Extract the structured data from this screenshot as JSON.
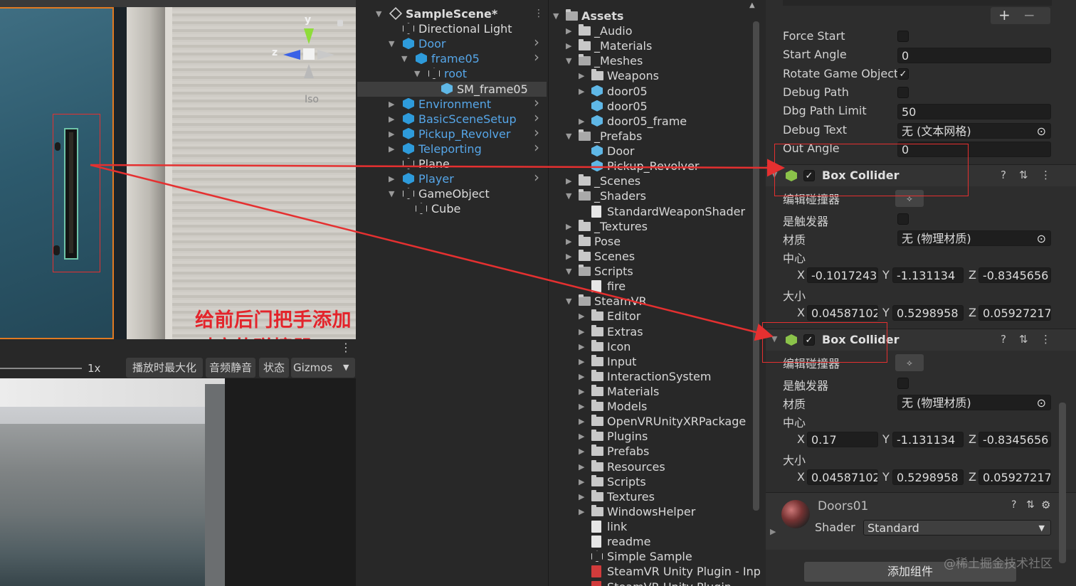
{
  "scene": {
    "gizmo": {
      "y": "y",
      "z": "z"
    },
    "projection": "Iso",
    "annotation": "给前后门把手添加对应的碰撞器"
  },
  "game_toolbar": {
    "scale": "1x",
    "maximize_on_play": "播放时最大化",
    "mute_audio": "音频静音",
    "stats": "状态",
    "gizmos": "Gizmos"
  },
  "hierarchy": {
    "items": [
      {
        "label": "SampleScene*",
        "depth": 0,
        "icon": "unity-scene-icon",
        "color": "white",
        "expanded": true,
        "bold": true,
        "menu": true
      },
      {
        "label": "Directional Light",
        "depth": 1,
        "icon": "gameobject-icon",
        "color": "white"
      },
      {
        "label": "Door",
        "depth": 1,
        "icon": "prefab-icon",
        "color": "blue",
        "expanded": true,
        "chevron": true
      },
      {
        "label": "frame05",
        "depth": 2,
        "icon": "prefab-icon",
        "color": "blue",
        "expanded": true,
        "chevron": true
      },
      {
        "label": "root",
        "depth": 3,
        "icon": "gameobject-icon",
        "color": "blue",
        "expanded": true
      },
      {
        "label": "SM_frame05",
        "depth": 4,
        "icon": "mesh-icon",
        "color": "white",
        "selected": true
      },
      {
        "label": "Environment",
        "depth": 1,
        "icon": "prefab-icon",
        "color": "blue",
        "collapsed": true,
        "chevron": true
      },
      {
        "label": "BasicSceneSetup",
        "depth": 1,
        "icon": "prefab-icon",
        "color": "blue",
        "collapsed": true,
        "chevron": true
      },
      {
        "label": "Pickup_Revolver",
        "depth": 1,
        "icon": "prefab-icon",
        "color": "blue",
        "collapsed": true,
        "chevron": true
      },
      {
        "label": "Teleporting",
        "depth": 1,
        "icon": "prefab-icon",
        "color": "blue",
        "collapsed": true,
        "chevron": true
      },
      {
        "label": "Plane",
        "depth": 1,
        "icon": "gameobject-icon",
        "color": "white"
      },
      {
        "label": "Player",
        "depth": 1,
        "icon": "prefab-icon",
        "color": "blue",
        "collapsed": true,
        "chevron": true
      },
      {
        "label": "GameObject",
        "depth": 1,
        "icon": "gameobject-icon",
        "color": "white",
        "expanded": true
      },
      {
        "label": "Cube",
        "depth": 2,
        "icon": "gameobject-icon",
        "color": "white"
      }
    ]
  },
  "project": {
    "items": [
      {
        "label": "Assets",
        "depth": 0,
        "type": "folder-open",
        "bold": true,
        "expanded": true
      },
      {
        "label": "_Audio",
        "depth": 1,
        "type": "folder",
        "collapsed": true
      },
      {
        "label": "_Materials",
        "depth": 1,
        "type": "folder",
        "collapsed": true
      },
      {
        "label": "_Meshes",
        "depth": 1,
        "type": "folder-open",
        "expanded": true
      },
      {
        "label": "Weapons",
        "depth": 2,
        "type": "folder",
        "collapsed": true
      },
      {
        "label": "door05",
        "depth": 2,
        "type": "model",
        "collapsed": true
      },
      {
        "label": "door05",
        "depth": 2,
        "type": "model"
      },
      {
        "label": "door05_frame",
        "depth": 2,
        "type": "model",
        "collapsed": true
      },
      {
        "label": "_Prefabs",
        "depth": 1,
        "type": "folder-open",
        "expanded": true
      },
      {
        "label": "Door",
        "depth": 2,
        "type": "prefab"
      },
      {
        "label": "Pickup_Revolver",
        "depth": 2,
        "type": "prefab"
      },
      {
        "label": "_Scenes",
        "depth": 1,
        "type": "folder",
        "collapsed": true
      },
      {
        "label": "_Shaders",
        "depth": 1,
        "type": "folder-open",
        "expanded": true
      },
      {
        "label": "StandardWeaponShader",
        "depth": 2,
        "type": "shader"
      },
      {
        "label": "_Textures",
        "depth": 1,
        "type": "folder",
        "collapsed": true
      },
      {
        "label": "Pose",
        "depth": 1,
        "type": "folder",
        "collapsed": true
      },
      {
        "label": "Scenes",
        "depth": 1,
        "type": "folder",
        "collapsed": true
      },
      {
        "label": "Scripts",
        "depth": 1,
        "type": "folder-open",
        "expanded": true
      },
      {
        "label": "fire",
        "depth": 2,
        "type": "script"
      },
      {
        "label": "SteamVR",
        "depth": 1,
        "type": "folder-open",
        "expanded": true
      },
      {
        "label": "Editor",
        "depth": 2,
        "type": "folder",
        "collapsed": true
      },
      {
        "label": "Extras",
        "depth": 2,
        "type": "folder",
        "collapsed": true
      },
      {
        "label": "Icon",
        "depth": 2,
        "type": "folder",
        "collapsed": true
      },
      {
        "label": "Input",
        "depth": 2,
        "type": "folder",
        "collapsed": true
      },
      {
        "label": "InteractionSystem",
        "depth": 2,
        "type": "folder",
        "collapsed": true
      },
      {
        "label": "Materials",
        "depth": 2,
        "type": "folder",
        "collapsed": true
      },
      {
        "label": "Models",
        "depth": 2,
        "type": "folder",
        "collapsed": true
      },
      {
        "label": "OpenVRUnityXRPackage",
        "depth": 2,
        "type": "folder",
        "collapsed": true
      },
      {
        "label": "Plugins",
        "depth": 2,
        "type": "folder",
        "collapsed": true
      },
      {
        "label": "Prefabs",
        "depth": 2,
        "type": "folder",
        "collapsed": true
      },
      {
        "label": "Resources",
        "depth": 2,
        "type": "folder",
        "collapsed": true
      },
      {
        "label": "Scripts",
        "depth": 2,
        "type": "folder",
        "collapsed": true
      },
      {
        "label": "Textures",
        "depth": 2,
        "type": "folder",
        "collapsed": true
      },
      {
        "label": "WindowsHelper",
        "depth": 2,
        "type": "folder",
        "collapsed": true
      },
      {
        "label": "link",
        "depth": 2,
        "type": "file"
      },
      {
        "label": "readme",
        "depth": 2,
        "type": "file"
      },
      {
        "label": "Simple Sample",
        "depth": 2,
        "type": "scene"
      },
      {
        "label": "SteamVR Unity Plugin - Inp",
        "depth": 2,
        "type": "pdf"
      },
      {
        "label": "SteamVR Unity Plugin",
        "depth": 2,
        "type": "pdf"
      }
    ]
  },
  "inspector": {
    "props": [
      {
        "label": "Force Start",
        "type": "checkbox",
        "checked": false
      },
      {
        "label": "Start Angle",
        "type": "field",
        "value": "0"
      },
      {
        "label": "Rotate Game Object",
        "type": "checkbox",
        "checked": true
      },
      {
        "label": "Debug Path",
        "type": "checkbox",
        "checked": false
      },
      {
        "label": "Dbg Path Limit",
        "type": "field",
        "value": "50"
      },
      {
        "label": "Debug Text",
        "type": "object",
        "value": "无 (文本网格)"
      },
      {
        "label": "Out Angle",
        "type": "field",
        "value": "0"
      }
    ],
    "colliders": [
      {
        "title": "Box Collider",
        "edit_label": "编辑碰撞器",
        "trigger_label": "是触发器",
        "material_label": "材质",
        "material_value": "无 (物理材质)",
        "center_label": "中心",
        "center": {
          "x": "-0.1017243",
          "y": "-1.131134",
          "z": "-0.8345656"
        },
        "size_label": "大小",
        "size": {
          "x": "0.04587102",
          "y": "0.5298958",
          "z": "0.05927217"
        }
      },
      {
        "title": "Box Collider",
        "edit_label": "编辑碰撞器",
        "trigger_label": "是触发器",
        "material_label": "材质",
        "material_value": "无 (物理材质)",
        "center_label": "中心",
        "center": {
          "x": "0.17",
          "y": "-1.131134",
          "z": "-0.8345656"
        },
        "size_label": "大小",
        "size": {
          "x": "0.04587102",
          "y": "0.5298958",
          "z": "0.05927217"
        }
      }
    ],
    "material": {
      "name": "Doors01",
      "shader_label": "Shader",
      "shader_value": "Standard"
    },
    "add_component": "添加组件",
    "axis": {
      "x": "X",
      "y": "Y",
      "z": "Z"
    }
  },
  "watermark": "@稀土掘金技术社区"
}
